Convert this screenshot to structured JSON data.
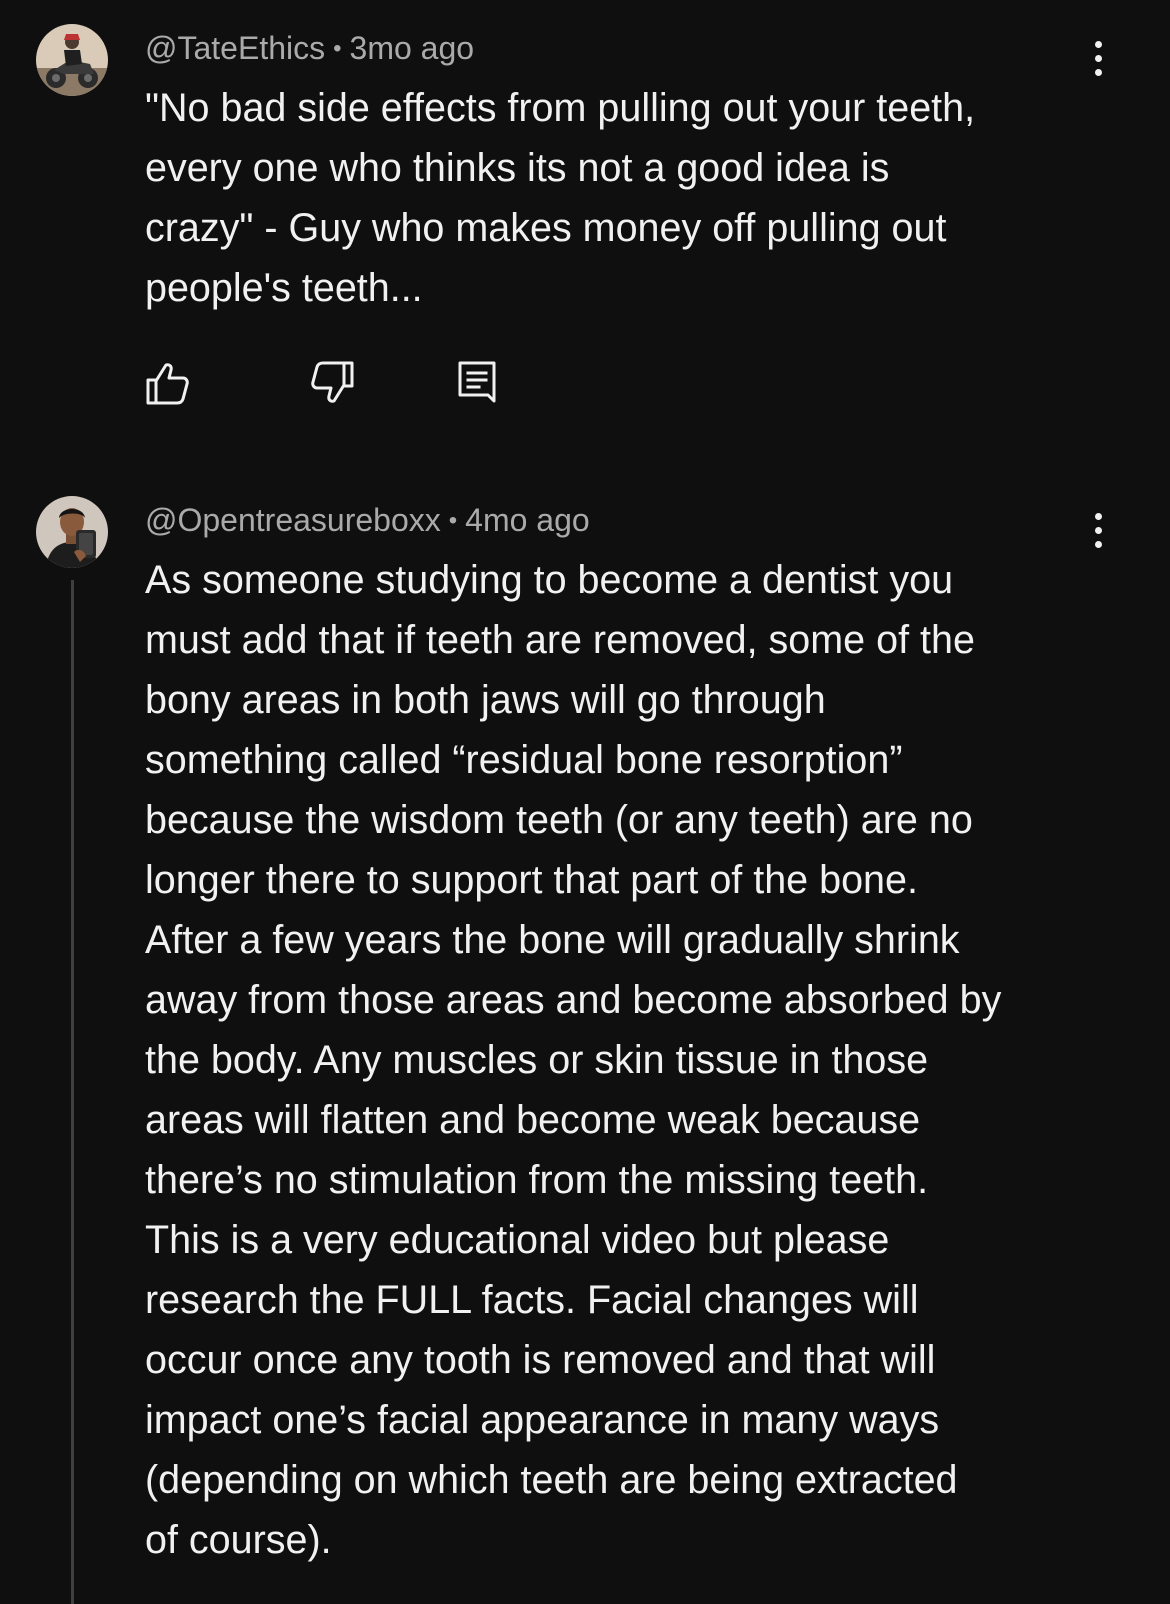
{
  "comments": [
    {
      "handle": "@TateEthics",
      "separator": "•",
      "time": "3mo ago",
      "lines": [
        "\"No bad side effects from pulling out your teeth,",
        "every one who thinks its not a good idea is",
        "crazy\" - Guy who makes money off pulling out",
        "people's teeth..."
      ],
      "actions": [
        {
          "name": "like-button",
          "icon": "thumbs-up-icon"
        },
        {
          "name": "dislike-button",
          "icon": "thumbs-down-icon"
        },
        {
          "name": "reply-button",
          "icon": "comment-reply-icon"
        }
      ],
      "avatar_icon": "avatar-motorcycle"
    },
    {
      "handle": "@Opentreasureboxx",
      "separator": "•",
      "time": "4mo ago",
      "lines": [
        "As someone studying to become a dentist you",
        "must add that if teeth are removed, some of the",
        "bony areas in both jaws will go through",
        "something called “residual bone resorption”",
        "because the wisdom teeth (or any teeth) are no",
        "longer there to support that part of the bone.",
        "After a few years the bone will gradually shrink",
        "away from those areas and become absorbed by",
        "the body. Any muscles or skin tissue in those",
        "areas will flatten and become weak because",
        "there’s no stimulation from the missing teeth.",
        "This is a very educational video but please",
        "research the FULL facts. Facial changes will",
        "occur once any tooth is removed and that will",
        "impact one’s facial appearance in many ways",
        "(depending on which teeth are being extracted",
        "of course)."
      ],
      "avatar_icon": "avatar-person-phone"
    }
  ],
  "colors": {
    "background": "#0f0f0f",
    "text": "#f1f1f1",
    "meta": "#aaaaaa",
    "thread_line": "#3f3f3f"
  }
}
